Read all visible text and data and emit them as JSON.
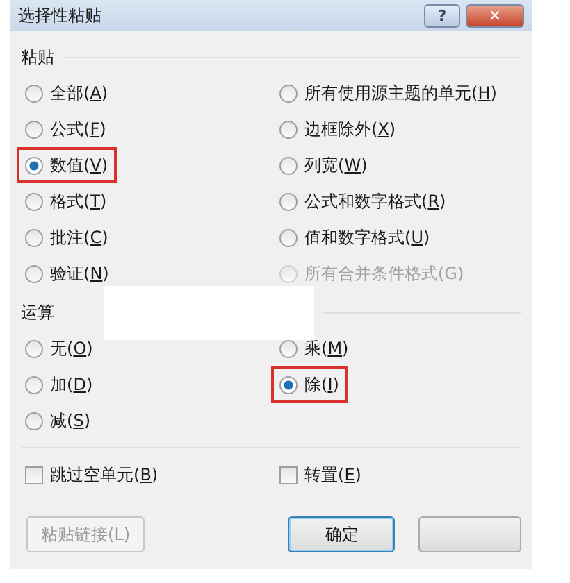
{
  "window": {
    "title": "选择性粘贴",
    "help_button": "?",
    "close_button": "✕"
  },
  "paste": {
    "heading": "粘贴",
    "options": [
      {
        "label": "全部(A)",
        "selected": false,
        "disabled": false,
        "highlighted": false,
        "underline_key": true
      },
      {
        "label": "所有使用源主题的单元(H)",
        "selected": false,
        "disabled": false,
        "highlighted": false,
        "underline_key": true
      },
      {
        "label": "公式(F)",
        "selected": false,
        "disabled": false,
        "highlighted": false,
        "underline_key": true
      },
      {
        "label": "边框除外(X)",
        "selected": false,
        "disabled": false,
        "highlighted": false,
        "underline_key": true
      },
      {
        "label": "数值(V)",
        "selected": true,
        "disabled": false,
        "highlighted": true,
        "underline_key": true
      },
      {
        "label": "列宽(W)",
        "selected": false,
        "disabled": false,
        "highlighted": false,
        "underline_key": true
      },
      {
        "label": "格式(T)",
        "selected": false,
        "disabled": false,
        "highlighted": false,
        "underline_key": true
      },
      {
        "label": "公式和数字格式(R)",
        "selected": false,
        "disabled": false,
        "highlighted": false,
        "underline_key": true
      },
      {
        "label": "批注(C)",
        "selected": false,
        "disabled": false,
        "highlighted": false,
        "underline_key": true
      },
      {
        "label": "值和数字格式(U)",
        "selected": false,
        "disabled": false,
        "highlighted": false,
        "underline_key": true
      },
      {
        "label": "验证(N)",
        "selected": false,
        "disabled": false,
        "highlighted": false,
        "underline_key": true
      },
      {
        "label": "所有合并条件格式(G)",
        "selected": false,
        "disabled": true,
        "highlighted": false,
        "underline_key": false
      }
    ]
  },
  "operation": {
    "heading": "运算",
    "options": [
      {
        "label": "无(O)",
        "selected": false,
        "disabled": false,
        "highlighted": false,
        "underline_key": true
      },
      {
        "label": "乘(M)",
        "selected": false,
        "disabled": false,
        "highlighted": false,
        "underline_key": true
      },
      {
        "label": "加(D)",
        "selected": false,
        "disabled": false,
        "highlighted": false,
        "underline_key": true
      },
      {
        "label": "除(I)",
        "selected": true,
        "disabled": false,
        "highlighted": true,
        "underline_key": true
      },
      {
        "label": "减(S)",
        "selected": false,
        "disabled": false,
        "highlighted": false,
        "underline_key": true
      }
    ]
  },
  "checkboxes": [
    {
      "label": "跳过空单元(B)",
      "checked": false,
      "underline_key": true
    },
    {
      "label": "转置(E)",
      "checked": false,
      "underline_key": true
    }
  ],
  "buttons": [
    {
      "label": "粘贴链接(L)",
      "disabled": true,
      "default": false
    },
    {
      "label": "确定",
      "disabled": false,
      "default": true
    },
    {
      "disabled": false,
      "default": false
    }
  ]
}
